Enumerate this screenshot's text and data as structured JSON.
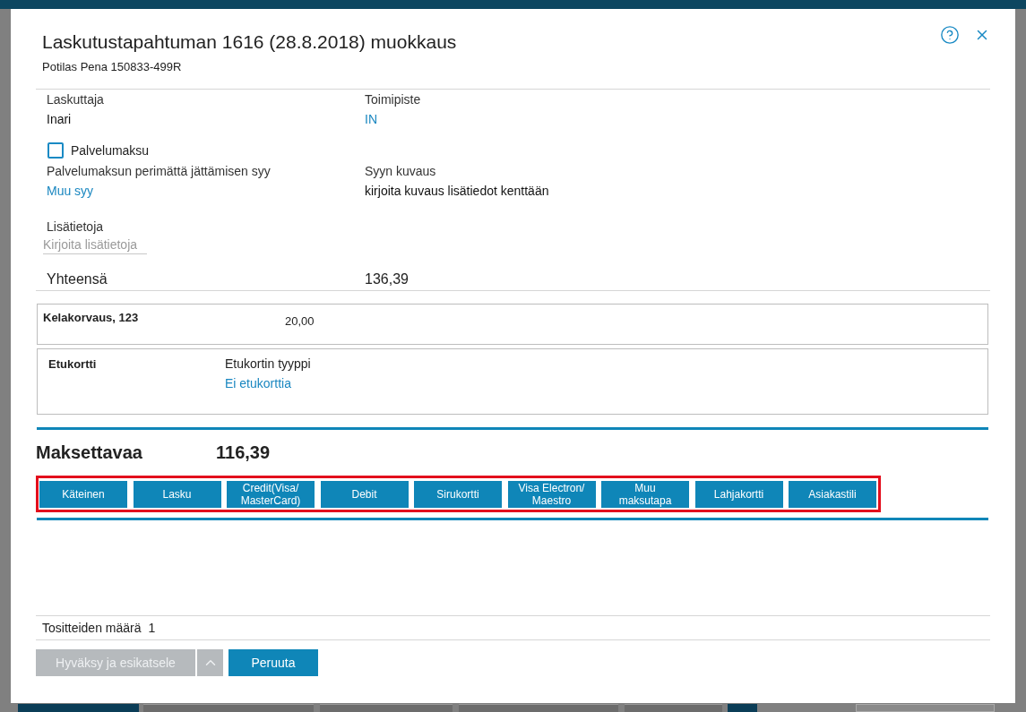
{
  "window": {
    "title": "Laskutustapahtuman 1616 (28.8.2018) muokkaus",
    "subtitle": "Potilas Pena 150833-499R"
  },
  "billing": [
    {
      "label": "Laskuttaja",
      "value": "Inari",
      "kind": "text"
    },
    {
      "label": "Toimipiste",
      "value": "IN",
      "kind": "link"
    }
  ],
  "service_fee": {
    "label": "Palvelumaksu",
    "checked": false
  },
  "waiver": [
    {
      "label": "Palvelumaksun perimättä jättämisen syy",
      "value": "Muu syy",
      "kind": "link"
    },
    {
      "label": "Syyn kuvaus",
      "value": "kirjoita kuvaus lisätiedot kenttään",
      "kind": "text"
    }
  ],
  "notes": {
    "label": "Lisätietoja",
    "placeholder": "Kirjoita lisätietoja"
  },
  "total": {
    "label": "Yhteensä",
    "value": "136,39"
  },
  "reimbursement": {
    "label": "Kelakorvaus, 123",
    "value": "20,00"
  },
  "benefit_card": {
    "label": "Etukortti",
    "type_label": "Etukortin tyyppi",
    "type_value": "Ei etukorttia"
  },
  "payable": {
    "label": "Maksettavaa",
    "value": "116,39"
  },
  "payment_methods": {
    "highlighted": true,
    "buttons": [
      "Käteinen",
      "Lasku",
      "Credit(Visa/\nMasterCard)",
      "Debit",
      "Sirukortti",
      "Visa Electron/\nMaestro",
      "Muu\nmaksutapa",
      "Lahjakortti",
      "Asiakastili"
    ]
  },
  "receipts": {
    "label": "Tositteiden määrä",
    "value": "1"
  },
  "actions": [
    {
      "label": "Hyväksy ja esikatsele",
      "kind": "split",
      "disabled": true
    },
    {
      "label": "Peruuta",
      "kind": "plain",
      "disabled": false
    }
  ]
}
